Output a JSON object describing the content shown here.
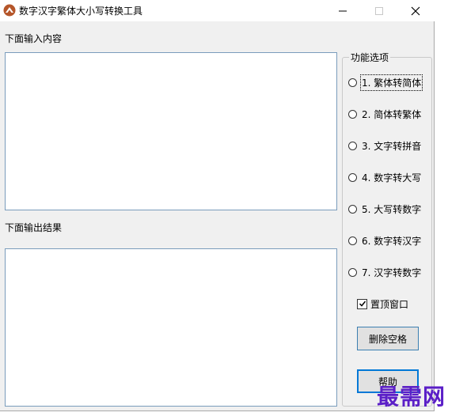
{
  "window": {
    "title": "数字汉字繁体大小写转换工具",
    "controls": {
      "minimize": "minimize",
      "maximize": "maximize",
      "close": "close"
    }
  },
  "input": {
    "label": "下面输入内容",
    "value": ""
  },
  "output": {
    "label": "下面输出结果",
    "value": ""
  },
  "options": {
    "title": "功能选项",
    "radios": [
      {
        "label": "1. 繁体转简体",
        "checked": false
      },
      {
        "label": "2. 简体转繁体",
        "checked": false
      },
      {
        "label": "3. 文字转拼音",
        "checked": false
      },
      {
        "label": "4. 数字转大写",
        "checked": false
      },
      {
        "label": "5. 大写转数字",
        "checked": false
      },
      {
        "label": "6. 数字转汉字",
        "checked": false
      },
      {
        "label": "7. 汉字转数字",
        "checked": false
      }
    ],
    "topmost": {
      "label": "置顶窗口",
      "checked": true
    },
    "remove_spaces_label": "删除空格",
    "help_label": "帮助"
  },
  "watermark": "最需网",
  "colors": {
    "accent": "#0078d7",
    "watermark": "#5b1fc7",
    "app_icon": "#b5562a"
  }
}
